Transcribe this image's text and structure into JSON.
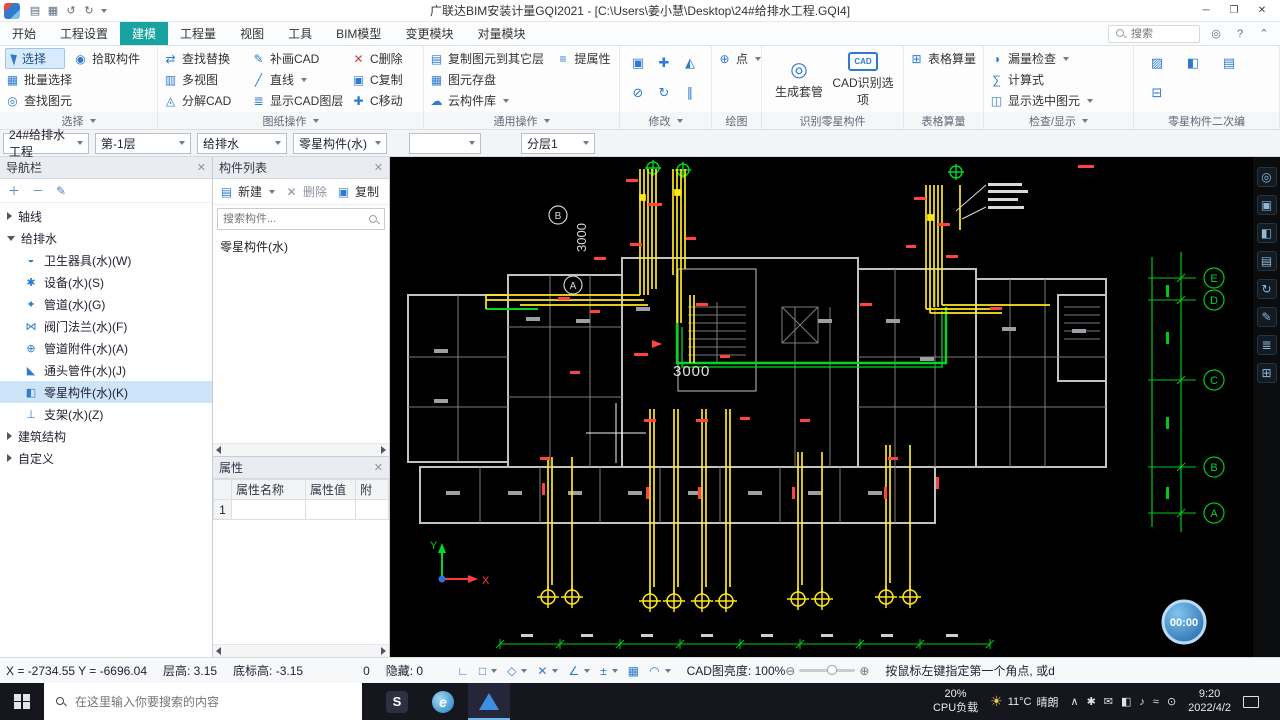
{
  "titlebar": {
    "title": "广联达BIM安装计量GQI2021 - [C:\\Users\\姜小慧\\Desktop\\24#给排水工程.GQI4]",
    "minimize": "─",
    "maximize": "❐",
    "close": "✕"
  },
  "menubar": {
    "tabs": [
      "开始",
      "工程设置",
      "建模",
      "工程量",
      "视图",
      "工具",
      "BIM模型",
      "变更模块",
      "对量模块"
    ],
    "active_tab": "建模",
    "search_placeholder": "搜索",
    "help": "?"
  },
  "ribbon": {
    "select": {
      "label": "选择",
      "main": "选择",
      "pick": "拾取构件",
      "batch": "批量选择",
      "find": "查找图元"
    },
    "sheet": {
      "label": "图纸操作",
      "r1": [
        "查找替换",
        "补画CAD",
        "C删除"
      ],
      "r2": [
        "多视图",
        "直线",
        "C复制"
      ],
      "r3": [
        "分解CAD",
        "显示CAD图层",
        "C移动"
      ]
    },
    "general": {
      "label": "通用操作",
      "copy_to": "复制图元到其它层",
      "extract": "提属性",
      "save_elem": "图元存盘",
      "cloud": "云构件库"
    },
    "modify": {
      "label": "修改"
    },
    "draw": {
      "label": "绘图",
      "point": "点"
    },
    "recognize": {
      "label": "识别零星构件",
      "sleeve": "生成套管",
      "cad_options": "CAD识别选项",
      "cad_badge": "CAD"
    },
    "table": {
      "label": "表格算量",
      "item": "表格算量"
    },
    "check": {
      "label": "检查/显示",
      "leak": "漏量检查",
      "formula": "计算式",
      "show_selected": "显示选中图元"
    },
    "misc": {
      "label": "零星构件二次编"
    }
  },
  "ctxbar": {
    "project": "24#给排水工程",
    "floor": "第-1层",
    "discipline": "给排水",
    "component": "零星构件(水)",
    "blank": "",
    "layer": "分层1"
  },
  "nav": {
    "title": "导航栏",
    "group_axis": "轴线",
    "group_plumbing": "给排水",
    "group_structure": "建筑结构",
    "group_custom": "自定义",
    "items": [
      "卫生器具(水)(W)",
      "设备(水)(S)",
      "管道(水)(G)",
      "阀门法兰(水)(F)",
      "管道附件(水)(A)",
      "通头管件(水)(J)",
      "零星构件(水)(K)",
      "支架(水)(Z)"
    ]
  },
  "components": {
    "title": "构件列表",
    "new": "新建",
    "del": "删除",
    "copy": "复制",
    "search_placeholder": "搜索构件...",
    "items": [
      "零星构件(水)"
    ]
  },
  "properties": {
    "title": "属性",
    "col_name": "属性名称",
    "col_value": "属性值",
    "col_attach": "附",
    "row1_index": "1"
  },
  "viewport": {
    "grid": [
      "E",
      "D",
      "C",
      "B",
      "A"
    ],
    "bubble_b": "B",
    "bubble_a": "A",
    "dim_v": "3000",
    "dim_h": "3000",
    "axis_x": "X",
    "axis_y": "Y",
    "timer": "00:00"
  },
  "statusbar": {
    "coords": "X = -2734.55 Y = -6696.04",
    "floor_height": "层高: 3.15",
    "bottom_elev": "底标高: -3.15",
    "count": "0",
    "hidden": "隐藏: 0",
    "brightness": "CAD图亮度: 100%",
    "prompt": "按鼠标左键指定第一个角点, 或d"
  },
  "taskbar": {
    "search_placeholder": "在这里输入你要搜索的内容",
    "cpu": "20%",
    "cpu_label": "CPU负载",
    "temp": "11°C",
    "weather": "晴朗",
    "time": "9:20",
    "date": "2022/4/2"
  }
}
